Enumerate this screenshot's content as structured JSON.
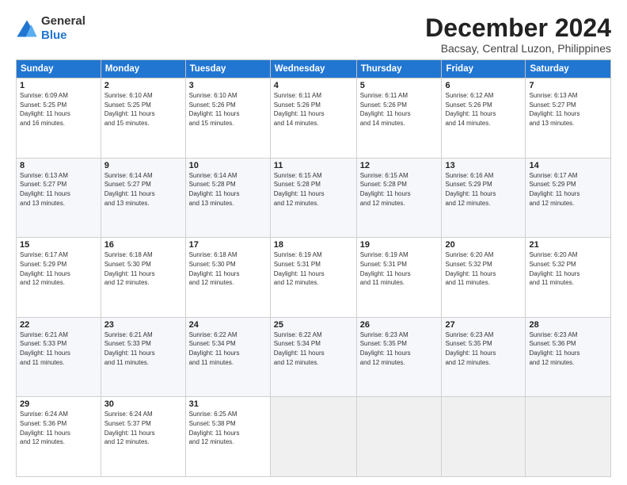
{
  "header": {
    "logo_general": "General",
    "logo_blue": "Blue",
    "month_title": "December 2024",
    "location": "Bacsay, Central Luzon, Philippines"
  },
  "days_of_week": [
    "Sunday",
    "Monday",
    "Tuesday",
    "Wednesday",
    "Thursday",
    "Friday",
    "Saturday"
  ],
  "weeks": [
    [
      {
        "day": "1",
        "info": "Sunrise: 6:09 AM\nSunset: 5:25 PM\nDaylight: 11 hours\nand 16 minutes."
      },
      {
        "day": "2",
        "info": "Sunrise: 6:10 AM\nSunset: 5:25 PM\nDaylight: 11 hours\nand 15 minutes."
      },
      {
        "day": "3",
        "info": "Sunrise: 6:10 AM\nSunset: 5:26 PM\nDaylight: 11 hours\nand 15 minutes."
      },
      {
        "day": "4",
        "info": "Sunrise: 6:11 AM\nSunset: 5:26 PM\nDaylight: 11 hours\nand 14 minutes."
      },
      {
        "day": "5",
        "info": "Sunrise: 6:11 AM\nSunset: 5:26 PM\nDaylight: 11 hours\nand 14 minutes."
      },
      {
        "day": "6",
        "info": "Sunrise: 6:12 AM\nSunset: 5:26 PM\nDaylight: 11 hours\nand 14 minutes."
      },
      {
        "day": "7",
        "info": "Sunrise: 6:13 AM\nSunset: 5:27 PM\nDaylight: 11 hours\nand 13 minutes."
      }
    ],
    [
      {
        "day": "8",
        "info": "Sunrise: 6:13 AM\nSunset: 5:27 PM\nDaylight: 11 hours\nand 13 minutes."
      },
      {
        "day": "9",
        "info": "Sunrise: 6:14 AM\nSunset: 5:27 PM\nDaylight: 11 hours\nand 13 minutes."
      },
      {
        "day": "10",
        "info": "Sunrise: 6:14 AM\nSunset: 5:28 PM\nDaylight: 11 hours\nand 13 minutes."
      },
      {
        "day": "11",
        "info": "Sunrise: 6:15 AM\nSunset: 5:28 PM\nDaylight: 11 hours\nand 12 minutes."
      },
      {
        "day": "12",
        "info": "Sunrise: 6:15 AM\nSunset: 5:28 PM\nDaylight: 11 hours\nand 12 minutes."
      },
      {
        "day": "13",
        "info": "Sunrise: 6:16 AM\nSunset: 5:29 PM\nDaylight: 11 hours\nand 12 minutes."
      },
      {
        "day": "14",
        "info": "Sunrise: 6:17 AM\nSunset: 5:29 PM\nDaylight: 11 hours\nand 12 minutes."
      }
    ],
    [
      {
        "day": "15",
        "info": "Sunrise: 6:17 AM\nSunset: 5:29 PM\nDaylight: 11 hours\nand 12 minutes."
      },
      {
        "day": "16",
        "info": "Sunrise: 6:18 AM\nSunset: 5:30 PM\nDaylight: 11 hours\nand 12 minutes."
      },
      {
        "day": "17",
        "info": "Sunrise: 6:18 AM\nSunset: 5:30 PM\nDaylight: 11 hours\nand 12 minutes."
      },
      {
        "day": "18",
        "info": "Sunrise: 6:19 AM\nSunset: 5:31 PM\nDaylight: 11 hours\nand 12 minutes."
      },
      {
        "day": "19",
        "info": "Sunrise: 6:19 AM\nSunset: 5:31 PM\nDaylight: 11 hours\nand 11 minutes."
      },
      {
        "day": "20",
        "info": "Sunrise: 6:20 AM\nSunset: 5:32 PM\nDaylight: 11 hours\nand 11 minutes."
      },
      {
        "day": "21",
        "info": "Sunrise: 6:20 AM\nSunset: 5:32 PM\nDaylight: 11 hours\nand 11 minutes."
      }
    ],
    [
      {
        "day": "22",
        "info": "Sunrise: 6:21 AM\nSunset: 5:33 PM\nDaylight: 11 hours\nand 11 minutes."
      },
      {
        "day": "23",
        "info": "Sunrise: 6:21 AM\nSunset: 5:33 PM\nDaylight: 11 hours\nand 11 minutes."
      },
      {
        "day": "24",
        "info": "Sunrise: 6:22 AM\nSunset: 5:34 PM\nDaylight: 11 hours\nand 11 minutes."
      },
      {
        "day": "25",
        "info": "Sunrise: 6:22 AM\nSunset: 5:34 PM\nDaylight: 11 hours\nand 12 minutes."
      },
      {
        "day": "26",
        "info": "Sunrise: 6:23 AM\nSunset: 5:35 PM\nDaylight: 11 hours\nand 12 minutes."
      },
      {
        "day": "27",
        "info": "Sunrise: 6:23 AM\nSunset: 5:35 PM\nDaylight: 11 hours\nand 12 minutes."
      },
      {
        "day": "28",
        "info": "Sunrise: 6:23 AM\nSunset: 5:36 PM\nDaylight: 11 hours\nand 12 minutes."
      }
    ],
    [
      {
        "day": "29",
        "info": "Sunrise: 6:24 AM\nSunset: 5:36 PM\nDaylight: 11 hours\nand 12 minutes."
      },
      {
        "day": "30",
        "info": "Sunrise: 6:24 AM\nSunset: 5:37 PM\nDaylight: 11 hours\nand 12 minutes."
      },
      {
        "day": "31",
        "info": "Sunrise: 6:25 AM\nSunset: 5:38 PM\nDaylight: 11 hours\nand 12 minutes."
      },
      {
        "day": "",
        "info": ""
      },
      {
        "day": "",
        "info": ""
      },
      {
        "day": "",
        "info": ""
      },
      {
        "day": "",
        "info": ""
      }
    ]
  ]
}
